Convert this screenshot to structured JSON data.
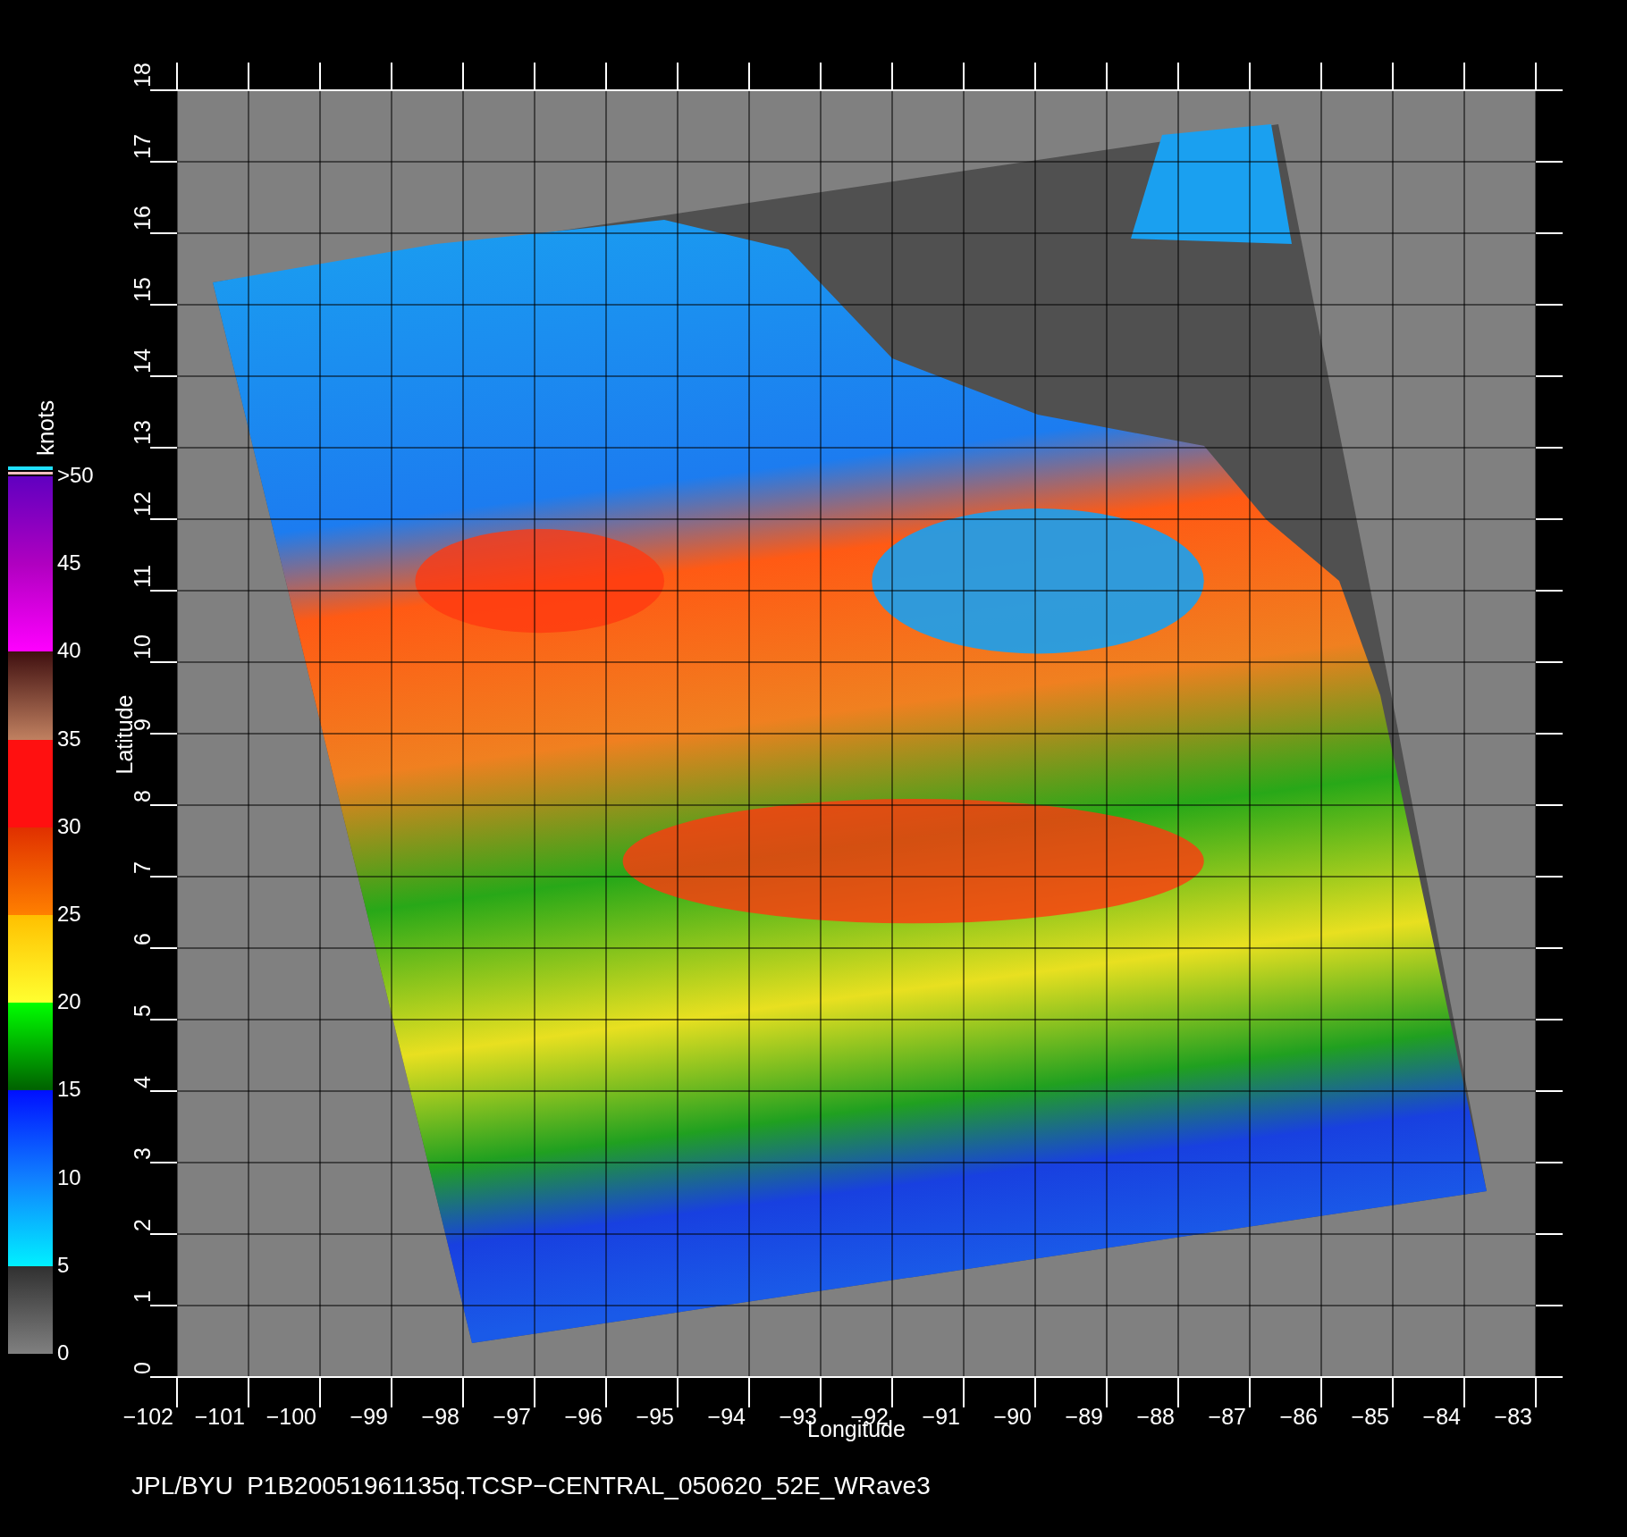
{
  "colorbar": {
    "unit": "knots",
    "labels": [
      ">50",
      "45",
      "40",
      "35",
      "30",
      "25",
      "20",
      "15",
      "10",
      "5",
      "0"
    ]
  },
  "plot": {
    "x_axis": {
      "label": "Longitude",
      "ticks": [
        "−102",
        "−101",
        "−100",
        "−99",
        "−98",
        "−97",
        "−96",
        "−95",
        "−94",
        "−93",
        "−92",
        "−91",
        "−90",
        "−89",
        "−88",
        "−87",
        "−86",
        "−85",
        "−84",
        "−83"
      ]
    },
    "y_axis": {
      "label": "Latitude",
      "ticks": [
        "0",
        "1",
        "2",
        "3",
        "4",
        "5",
        "6",
        "7",
        "8",
        "9",
        "10",
        "11",
        "12",
        "13",
        "14",
        "15",
        "16",
        "17",
        "18"
      ]
    }
  },
  "caption": "JPL/BYU  P1B20051961135q.TCSP−CENTRAL_050620_52E_WRave3"
}
